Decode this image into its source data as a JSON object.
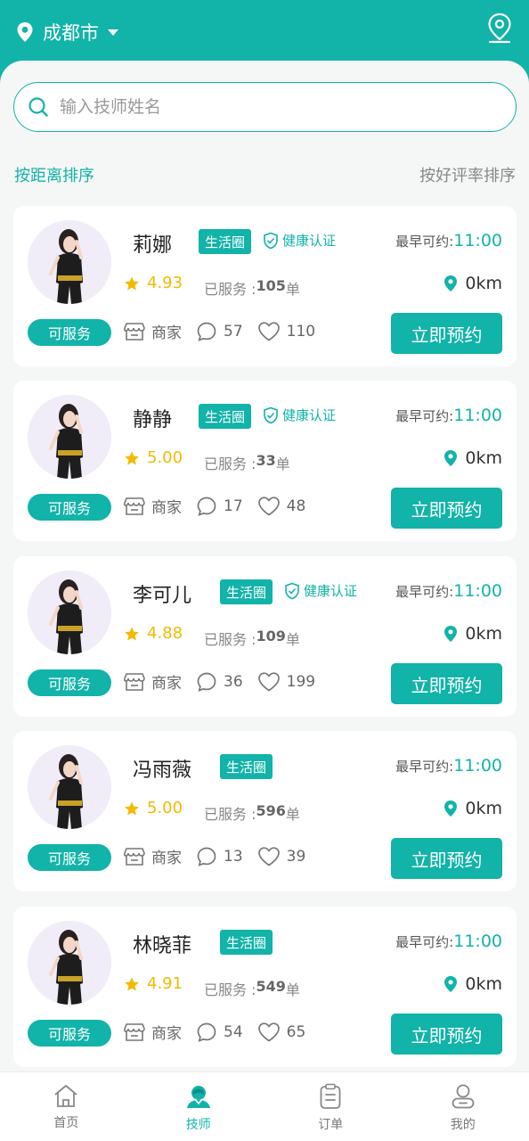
{
  "header": {
    "city": "成都市"
  },
  "search": {
    "placeholder": "输入技师姓名"
  },
  "sort": {
    "by_distance": "按距离排序",
    "by_rating": "按好评率排序"
  },
  "labels": {
    "status": "可服务",
    "life_tag": "生活圈",
    "health_tag": "健康认证",
    "earliest": "最早可约:",
    "served": "已服务 :",
    "order_unit": "单",
    "merchant": "商家",
    "book": "立即预约"
  },
  "technicians": [
    {
      "name": "莉娜",
      "health": true,
      "time": "11:00",
      "rating": "4.93",
      "served": "105",
      "distance": "0km",
      "comments": "57",
      "likes": "110"
    },
    {
      "name": "静静",
      "health": true,
      "time": "11:00",
      "rating": "5.00",
      "served": "33",
      "distance": "0km",
      "comments": "17",
      "likes": "48"
    },
    {
      "name": "李可儿",
      "health": true,
      "time": "11:00",
      "rating": "4.88",
      "served": "109",
      "distance": "0km",
      "comments": "36",
      "likes": "199"
    },
    {
      "name": "冯雨薇",
      "health": false,
      "time": "11:00",
      "rating": "5.00",
      "served": "596",
      "distance": "0km",
      "comments": "13",
      "likes": "39"
    },
    {
      "name": "林晓菲",
      "health": false,
      "time": "11:00",
      "rating": "4.91",
      "served": "549",
      "distance": "0km",
      "comments": "54",
      "likes": "65"
    }
  ],
  "tabs": [
    {
      "label": "首页",
      "icon": "home-icon",
      "active": false
    },
    {
      "label": "技师",
      "icon": "technician-icon",
      "active": true
    },
    {
      "label": "订单",
      "icon": "order-icon",
      "active": false
    },
    {
      "label": "我的",
      "icon": "profile-icon",
      "active": false
    }
  ],
  "colors": {
    "primary": "#12b3a8",
    "star": "#f5b800"
  }
}
